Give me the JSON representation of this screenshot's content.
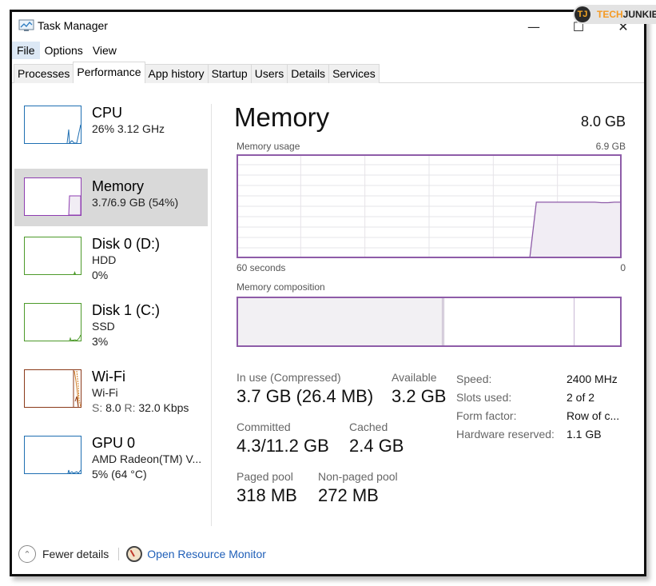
{
  "window": {
    "title": "Task Manager",
    "controls": {
      "minimize": "—",
      "maximize": "☐",
      "close": "✕"
    }
  },
  "watermark": {
    "logo": "TJ",
    "tech": "TECH",
    "junkie": "JUNKIE"
  },
  "menu": [
    "File",
    "Options",
    "View"
  ],
  "tabs": [
    "Processes",
    "Performance",
    "App history",
    "Startup",
    "Users",
    "Details",
    "Services"
  ],
  "active_tab": "Performance",
  "sidebar": [
    {
      "id": "cpu",
      "title": "CPU",
      "lines": [
        "26% 3.12 GHz"
      ],
      "color": "#1f6fb2"
    },
    {
      "id": "memory",
      "title": "Memory",
      "lines": [
        "3.7/6.9 GB (54%)"
      ],
      "color": "#8e3cb0",
      "active": true
    },
    {
      "id": "disk0",
      "title": "Disk 0 (D:)",
      "lines": [
        "HDD",
        "0%"
      ],
      "color": "#4d9a2a"
    },
    {
      "id": "disk1",
      "title": "Disk 1 (C:)",
      "lines": [
        "SSD",
        "3%"
      ],
      "color": "#4d9a2a"
    },
    {
      "id": "wifi",
      "title": "Wi-Fi",
      "lines": [
        "Wi-Fi"
      ],
      "send_label": "S:",
      "send_value": "8.0",
      "recv_label": "R:",
      "recv_value": "32.0 Kbps",
      "color": "#8b3a1a"
    },
    {
      "id": "gpu0",
      "title": "GPU 0",
      "lines": [
        "AMD Radeon(TM) V...",
        "5% (64 °C)"
      ],
      "color": "#1f6fb2"
    }
  ],
  "main": {
    "title": "Memory",
    "total": "8.0 GB",
    "usage_label": "Memory usage",
    "usage_max": "6.9 GB",
    "axis_left": "60 seconds",
    "axis_right": "0",
    "composition_label": "Memory composition",
    "accent": "#8e5ca8",
    "usage_history_fraction": [
      0,
      0,
      0,
      0,
      0,
      0,
      0,
      0,
      0,
      0,
      0,
      0,
      0,
      0,
      0,
      0,
      0,
      0,
      0,
      0,
      0,
      0,
      0,
      0,
      0,
      0,
      0,
      0,
      0,
      0,
      0,
      0,
      0,
      0,
      0,
      0,
      0,
      0,
      0,
      0,
      0,
      0,
      0,
      0,
      0,
      0,
      0.54,
      0.54,
      0.54,
      0.54,
      0.54,
      0.54,
      0.54,
      0.54,
      0.54,
      0.54,
      0.535,
      0.535,
      0.54,
      0.54
    ],
    "composition_fractions": {
      "in_use": 0.535,
      "modified": 0.005,
      "standby": 0.34,
      "free": 0.12
    }
  },
  "stats": {
    "in_use": {
      "label": "In use (Compressed)",
      "value": "3.7 GB (26.4 MB)"
    },
    "available": {
      "label": "Available",
      "value": "3.2 GB"
    },
    "committed": {
      "label": "Committed",
      "value": "4.3/11.2 GB"
    },
    "cached": {
      "label": "Cached",
      "value": "2.4 GB"
    },
    "paged_pool": {
      "label": "Paged pool",
      "value": "318 MB"
    },
    "non_paged_pool": {
      "label": "Non-paged pool",
      "value": "272 MB"
    }
  },
  "specs": [
    {
      "key": "Speed:",
      "value": "2400 MHz"
    },
    {
      "key": "Slots used:",
      "value": "2 of 2"
    },
    {
      "key": "Form factor:",
      "value": "Row of c..."
    },
    {
      "key": "Hardware reserved:",
      "value": "1.1 GB"
    }
  ],
  "footer": {
    "fewer_details": "Fewer details",
    "open_resource_monitor": "Open Resource Monitor"
  }
}
